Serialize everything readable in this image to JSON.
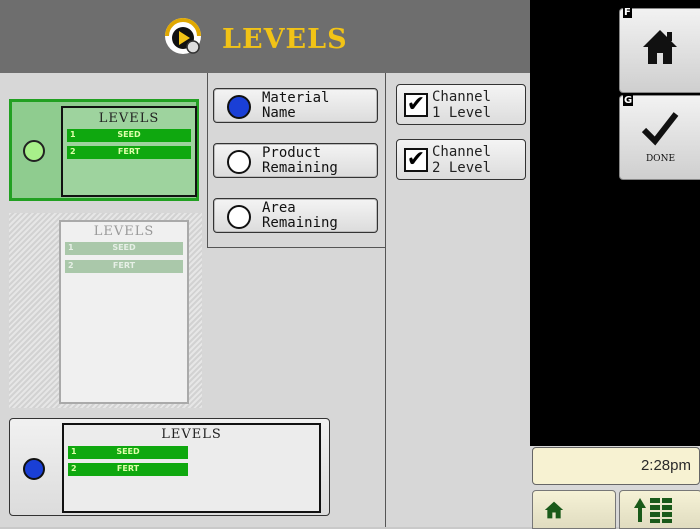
{
  "header": {
    "title": "LEVELS",
    "logo_icon": "rate-gauge-icon"
  },
  "layouts": [
    {
      "state": "selected",
      "title": "LEVELS",
      "rows": [
        {
          "num": "1",
          "label": "SEED"
        },
        {
          "num": "2",
          "label": "FERT"
        }
      ]
    },
    {
      "state": "disabled",
      "title": "LEVELS",
      "rows": [
        {
          "num": "1",
          "label": "SEED"
        },
        {
          "num": "2",
          "label": "FERT"
        }
      ]
    },
    {
      "state": "active",
      "title": "LEVELS",
      "rows": [
        {
          "num": "1",
          "label": "SEED"
        },
        {
          "num": "2",
          "label": "FERT"
        }
      ]
    }
  ],
  "options": [
    {
      "label": "Material\nName",
      "selected": true
    },
    {
      "label": "Product\nRemaining",
      "selected": false
    },
    {
      "label": "Area\nRemaining",
      "selected": false
    }
  ],
  "checkboxes": [
    {
      "label": "Channel\n1 Level",
      "checked": true
    },
    {
      "label": "Channel\n2 Level",
      "checked": true
    }
  ],
  "softkeys": {
    "home": {
      "letter": "F",
      "icon": "home-icon"
    },
    "done": {
      "letter": "G",
      "icon": "checkmark-icon",
      "label": "DONE"
    }
  },
  "status": {
    "time": "2:28pm"
  },
  "bottom_buttons": {
    "home_icon": "home-icon",
    "menu_icon": "up-arrow-grid-icon"
  },
  "colors": {
    "title": "#f2c316",
    "level_bar": "#0fa80f",
    "selected_radio": "#1a3fd6",
    "selected_layout": "#8fcc8f"
  }
}
